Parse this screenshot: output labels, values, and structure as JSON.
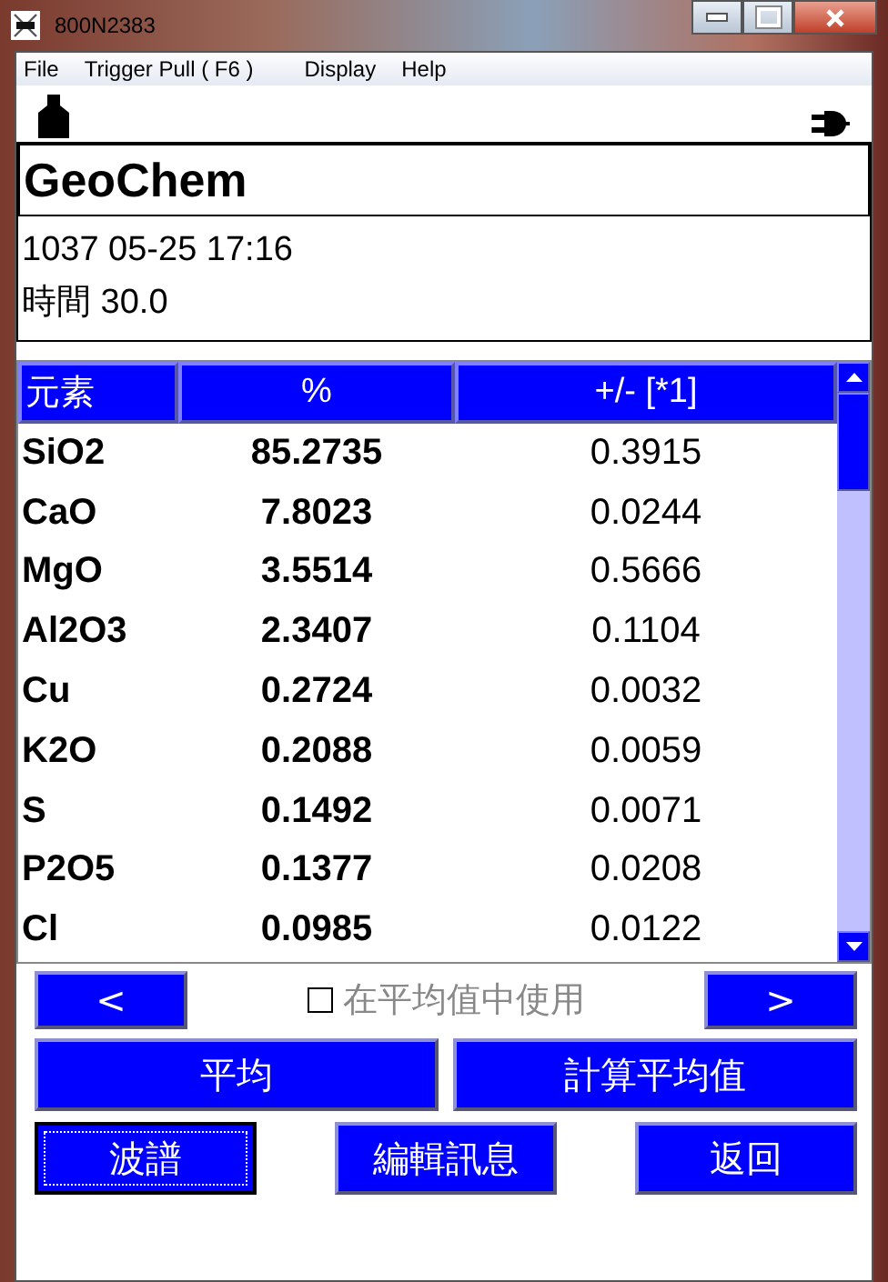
{
  "window": {
    "title": "800N2383"
  },
  "menu": [
    "File",
    "Trigger Pull ( F6 )",
    "Display",
    "Help"
  ],
  "header": {
    "title": "GeoChem"
  },
  "info": {
    "line_1": "1037  05-25 17:16",
    "line_2": "時間 30.0"
  },
  "table": {
    "columns": [
      "元素",
      "%",
      "+/- [*1]"
    ],
    "rows": [
      [
        "SiO2",
        "85.2735",
        "0.3915"
      ],
      [
        "CaO",
        "7.8023",
        "0.0244"
      ],
      [
        "MgO",
        "3.5514",
        "0.5666"
      ],
      [
        "Al2O3",
        "2.3407",
        "0.1104"
      ],
      [
        "Cu",
        "0.2724",
        "0.0032"
      ],
      [
        "K2O",
        "0.2088",
        "0.0059"
      ],
      [
        "S",
        "0.1492",
        "0.0071"
      ],
      [
        "P2O5",
        "0.1377",
        "0.0208"
      ],
      [
        "Cl",
        "0.0985",
        "0.0122"
      ]
    ]
  },
  "nav": {
    "prev": "<",
    "next": ">",
    "checkbox": {
      "label": "在平均值中使用",
      "checked": false,
      "disabled": true
    }
  },
  "buttons": [
    {
      "label": "平均",
      "focused": false
    },
    {
      "label": "計算平均值",
      "focused": false
    }
  ],
  "bottom_buttons": [
    {
      "label": "波譜",
      "focused": true
    },
    {
      "label": "編輯訊息",
      "focused": false
    },
    {
      "label": "返回",
      "focused": false
    }
  ]
}
